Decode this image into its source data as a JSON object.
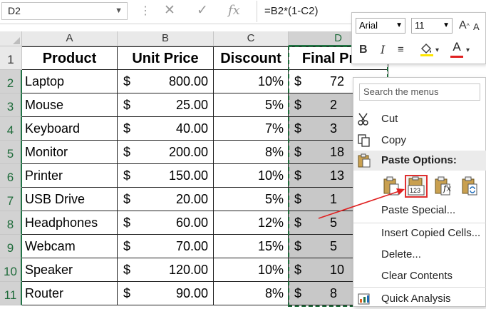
{
  "formula_bar": {
    "name_box": "D2",
    "cancel_icon": "✕",
    "enter_icon": "✓",
    "fx_label": "fx",
    "formula": "=B2*(1-C2)"
  },
  "columns": [
    "A",
    "B",
    "C",
    "D"
  ],
  "rows": [
    "1",
    "2",
    "3",
    "4",
    "5",
    "6",
    "7",
    "8",
    "9",
    "10",
    "11"
  ],
  "headers": [
    "Product",
    "Unit Price",
    "Discount",
    "Final Price"
  ],
  "currency_symbol": "$",
  "data_rows": [
    {
      "product": "Laptop",
      "price": "800.00",
      "discount": "10%",
      "final": "72"
    },
    {
      "product": "Mouse",
      "price": "25.00",
      "discount": "5%",
      "final": "2"
    },
    {
      "product": "Keyboard",
      "price": "40.00",
      "discount": "7%",
      "final": "3"
    },
    {
      "product": "Monitor",
      "price": "200.00",
      "discount": "8%",
      "final": "18"
    },
    {
      "product": "Printer",
      "price": "150.00",
      "discount": "10%",
      "final": "13"
    },
    {
      "product": "USB Drive",
      "price": "20.00",
      "discount": "5%",
      "final": "1"
    },
    {
      "product": "Headphones",
      "price": "60.00",
      "discount": "12%",
      "final": "5"
    },
    {
      "product": "Webcam",
      "price": "70.00",
      "discount": "15%",
      "final": "5"
    },
    {
      "product": "Speaker",
      "price": "120.00",
      "discount": "10%",
      "final": "10"
    },
    {
      "product": "Router",
      "price": "90.00",
      "discount": "8%",
      "final": "8"
    }
  ],
  "mini_toolbar": {
    "font": "Arial",
    "size": "11",
    "grow": "A",
    "shrink": "A",
    "bold": "B",
    "italic": "I",
    "font_color_letter": "A",
    "font_color": "#e02020"
  },
  "context_menu": {
    "search_placeholder": "Search the menus",
    "cut": "Cut",
    "copy": "Copy",
    "paste_options": "Paste Options:",
    "paste_values_label": "123",
    "paste_formula_label": "fx",
    "paste_special": "Paste Special...",
    "insert_copied": "Insert Copied Cells...",
    "delete": "Delete...",
    "clear_contents": "Clear Contents",
    "quick_analysis": "Quick Analysis"
  },
  "colors": {
    "selection_green": "#217346",
    "highlight_red": "#e03030"
  }
}
